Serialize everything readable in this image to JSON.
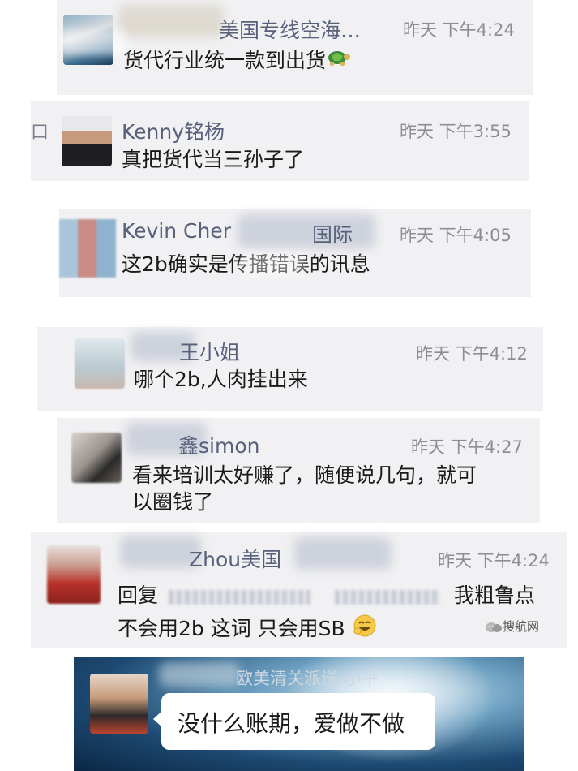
{
  "chats": [
    {
      "name_visible": "美国专线空海…",
      "time": "昨天 下午4:24",
      "message": "货代行业统一款到出货"
    },
    {
      "name_visible": "Kenny铭杨",
      "time": "昨天 下午3:55",
      "message": "真把货代当三孙子了"
    },
    {
      "name_visible": "Kevin Cher",
      "name_suffix": "国际",
      "time": "昨天 下午4:05",
      "message": "这2b确实是传播错误的讯息"
    },
    {
      "name_visible": "王小姐",
      "time": "昨天 下午4:12",
      "message": "哪个2b,人肉挂出来"
    },
    {
      "name_visible": "鑫simon",
      "time": "昨天 下午4:27",
      "message_line1": "看来培训太好赚了，随便说几句，就可",
      "message_line2": "以圈钱了"
    },
    {
      "name_visible": "Zhou美国",
      "time": "昨天 下午4:24",
      "message_prefix": "回复",
      "message_tail": "我粗鲁点",
      "message_line2": "不会用2b 这词 只会用SB"
    },
    {
      "name_visible": "欧美清关派送-小平",
      "message": "没什么账期，爱做不做"
    }
  ],
  "left_edge_char": "口",
  "watermark": "搜航网",
  "colors": {
    "card_bg": "#f1f1f3",
    "name": "#57607a",
    "time": "#8d8d93",
    "text": "#1a1a1a"
  }
}
